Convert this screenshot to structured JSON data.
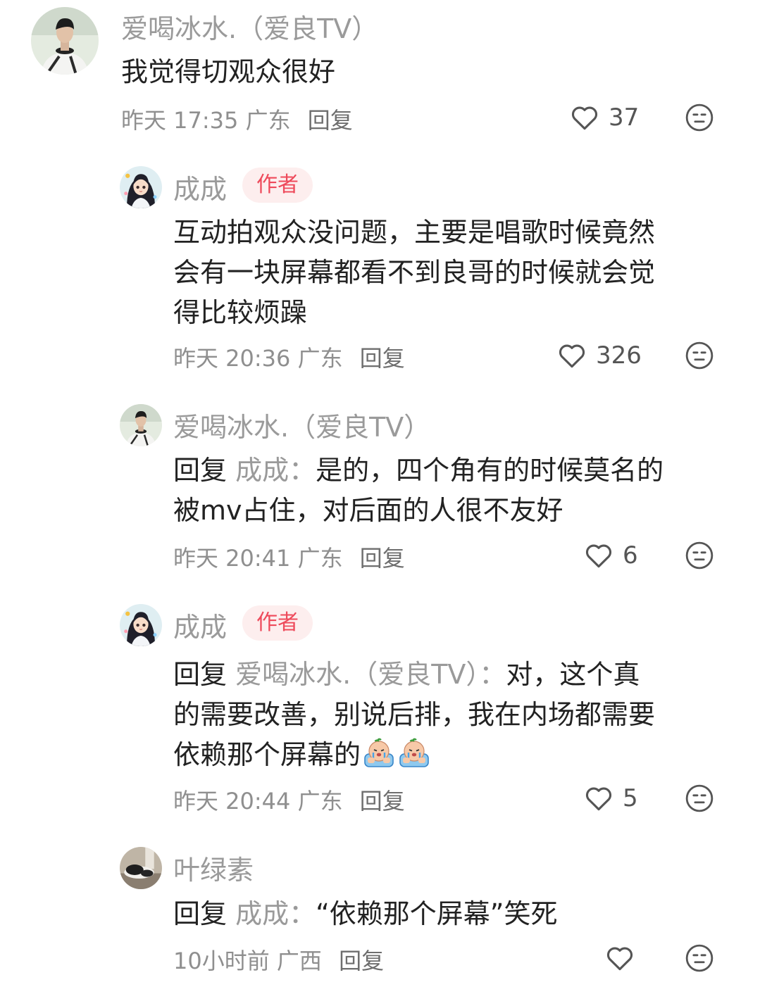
{
  "comments": [
    {
      "user": "爱喝冰水.（爱良TV）",
      "text": "我觉得切观众很好",
      "time": "昨天 17:35",
      "location": "广东",
      "reply_label": "回复",
      "likes": "37"
    },
    {
      "user": "成成",
      "badge": "作者",
      "lines": [
        "互动拍观众没问题，主要是唱歌时候竟然",
        "会有一块屏幕都看不到良哥的时候就会觉",
        "得比较烦躁"
      ],
      "time": "昨天 20:36",
      "location": "广东",
      "reply_label": "回复",
      "likes": "326"
    },
    {
      "user": "爱喝冰水.（爱良TV）",
      "reply_prefix": "回复",
      "reply_to": "成成：",
      "line1": "是的，四个角有的时候莫名的",
      "line2": "被mv占住，对后面的人很不友好",
      "time": "昨天 20:41",
      "location": "广东",
      "reply_label": "回复",
      "likes": "6"
    },
    {
      "user": "成成",
      "badge": "作者",
      "reply_prefix": "回复",
      "reply_to": "爱喝冰水.（爱良TV）：",
      "line1": "对，这个真",
      "line2": "的需要改善，别说后排，我在内场都需要",
      "line3": "依赖那个屏幕的",
      "time": "昨天 20:44",
      "location": "广东",
      "reply_label": "回复",
      "likes": "5"
    },
    {
      "user": "叶绿素",
      "reply_prefix": "回复",
      "reply_to": "成成：",
      "line1": "“依赖那个屏幕”笑死",
      "time": "10小时前",
      "location": "广西",
      "reply_label": "回复",
      "likes": ""
    }
  ],
  "icons": {
    "like": "heart-outline-icon",
    "dislike": "neutral-face-icon",
    "emoji": "crying-peach-emoji"
  },
  "colors": {
    "name": "#9a9a9a",
    "badge_bg": "#fdeeee",
    "badge_text": "#ee4a5b",
    "text": "#222222"
  }
}
